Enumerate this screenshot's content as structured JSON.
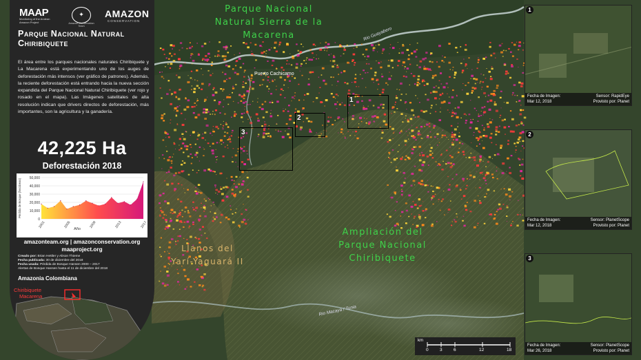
{
  "logos": {
    "maap": "MAAP",
    "maap_sub": "Monitoring of the Andean Amazon Project",
    "acca_sub": "Amazon Conservation Team",
    "amazon": "AMAZON",
    "amazon_sub": "CONSERVATION"
  },
  "panel": {
    "title_line1": "Parque Nacional Natural",
    "title_line2": "Chiribiquete",
    "description": "El área entre los parques nacionales naturales Chiribiquete y La Macarena está experimentando uno de los auges de deforestación más intensos (ver gráfico de patrones). Además, la reciente deforestación está entrando hacia la nueva sección expandida del Parque Nacional Natural Chiribiquete (ver rojo y rosado en el mapa). Las Imágenes satelitales de alta resolución indican que drivers directos de deforestación, más importantes, son la agricultura y la ganadería.",
    "big_number": "42,225 Ha",
    "subtitle": "Deforestación 2018",
    "links_line1": "amazonteam.org  |  amazonconservation.org",
    "links_line2": "maaproject.org",
    "credits": [
      {
        "label": "Creado por:",
        "value": "Brian Hettler y Alison Thieme"
      },
      {
        "label": "Fecha publicada:",
        "value": "30 de diciembre del 2018"
      },
      {
        "label": "Fecha usada:",
        "value": "Pérdida de Bosque Hansen 2000 – 2017"
      },
      {
        "label": "",
        "value": "Alertas de Bosque Hansen hasta el 11 de diciembre del 2018"
      }
    ],
    "amazonia_title": "Amazonia Colombiana",
    "minimap_labels": [
      "Chiribiquete",
      "Macarena"
    ]
  },
  "chart_data": {
    "type": "area",
    "x": [
      2001,
      2002,
      2003,
      2004,
      2005,
      2006,
      2007,
      2008,
      2009,
      2010,
      2011,
      2012,
      2013,
      2014,
      2015,
      2016,
      2017
    ],
    "values": [
      18000,
      13000,
      15000,
      22000,
      12000,
      15000,
      17000,
      22000,
      19000,
      16000,
      18000,
      26000,
      19000,
      21000,
      17000,
      24000,
      45000
    ],
    "xlabel": "Año",
    "ylabel": "Pérdida de Bosque (hectáreas)",
    "ylim": [
      0,
      50000
    ],
    "y_ticks": [
      "50,000",
      "40,000",
      "30,000",
      "20,000",
      "10,000",
      "0"
    ],
    "x_ticks": [
      "2001",
      "2005",
      "2009",
      "2013",
      "2017"
    ],
    "colors": {
      "start": "#ffe23a",
      "mid": "#ff4d4d",
      "end": "#d6197a"
    }
  },
  "map": {
    "labels": {
      "macarena_park": [
        "Parque Nacional",
        "Natural Sierra de la",
        "Macarena"
      ],
      "chiribiquete_ext": [
        "Ampliación del",
        "Parque Nacional",
        "Chiribiquete"
      ],
      "llanos": [
        "Llanos del",
        "Yarí-Yaguará II"
      ]
    },
    "rivers": {
      "guayabero": "Rio Guayabero",
      "macaya": "Rio Macaya / Tunia"
    },
    "town": "Puerto Cachicamo",
    "boxes": [
      "1",
      "2",
      "3"
    ],
    "colors": {
      "forest": "#34452c",
      "park_overlay": "#4f5a36",
      "loss_yellow": "#ffd43a",
      "loss_orange": "#ff8a1a",
      "loss_red": "#ff3a3a",
      "loss_pink": "#e0289b"
    }
  },
  "insets": [
    {
      "num": "1",
      "date_label": "Fecha de Imagen:",
      "date": "Mar 12, 2018",
      "sensor": "Sensor: RapidEye",
      "provider": "Provisto por: Planet"
    },
    {
      "num": "2",
      "date_label": "Fecha de Imagen:",
      "date": "Mar 12, 2018",
      "sensor": "Sensor: PlanetScope",
      "provider": "Provisto por: Planet"
    },
    {
      "num": "3",
      "date_label": "Fecha de Imagen:",
      "date": "Mar 26, 2018",
      "sensor": "Sensor: PlanetScope",
      "provider": "Provisto por: Planet"
    }
  ],
  "scale": {
    "unit": "km",
    "ticks": [
      "0",
      "3",
      "6",
      "12",
      "18"
    ]
  }
}
